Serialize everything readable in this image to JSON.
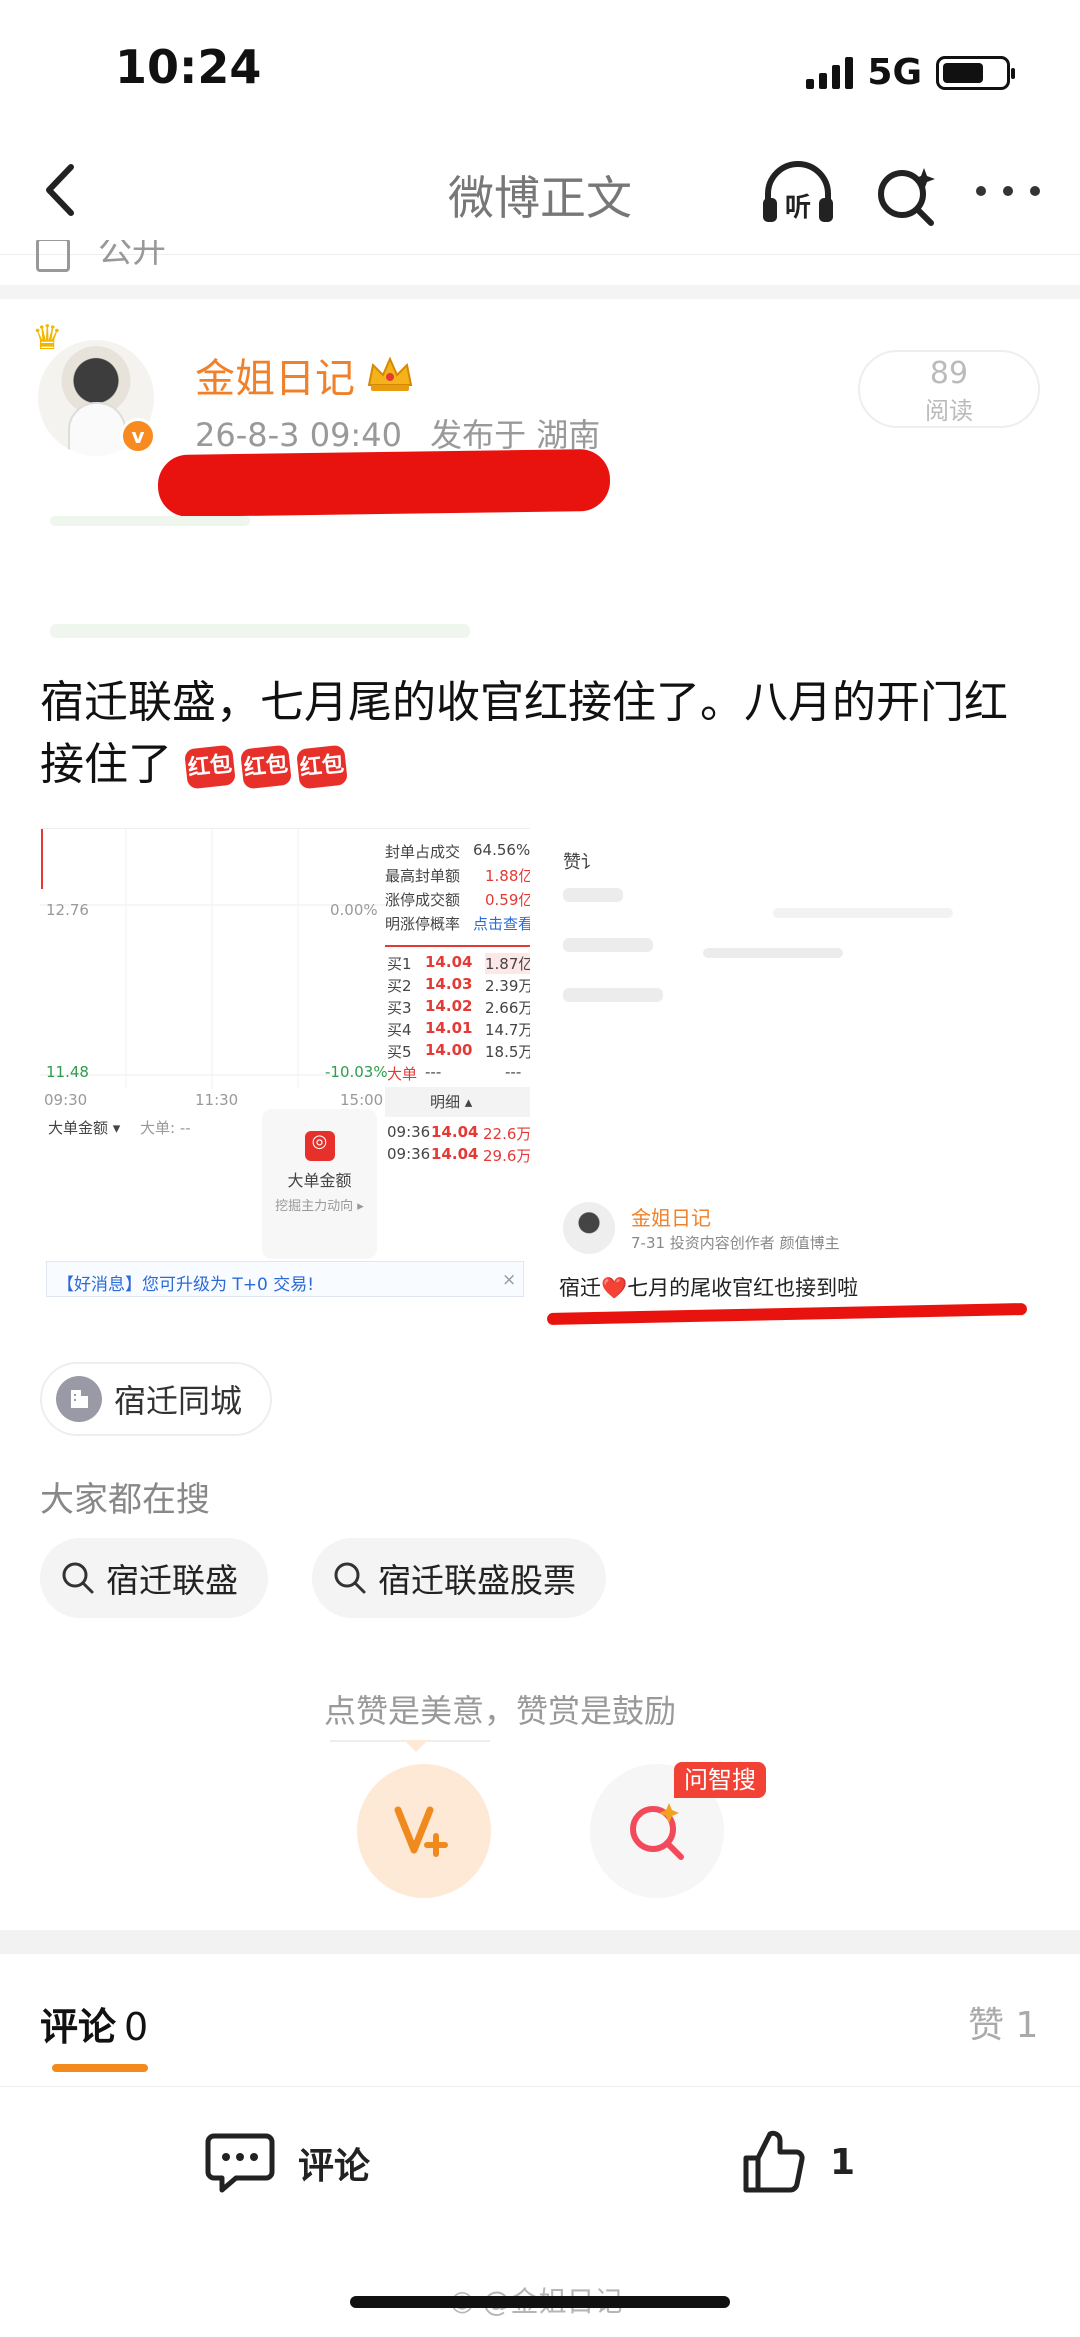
{
  "status_bar": {
    "time": "10:24",
    "network": "5G"
  },
  "nav": {
    "title": "微博正文",
    "listen_label": "听"
  },
  "cut_row": {
    "text": "公开"
  },
  "post": {
    "username": "金姐日记",
    "timestamp": "26-8-3 09:40",
    "location": "发布于 湖南",
    "read_count": "89",
    "read_label": "阅读",
    "text": "宿迁联盛，七月尾的收官红接住了。八月的开门红接住了",
    "emoji_label": "红包"
  },
  "stock_image": {
    "stats": [
      {
        "label": "封单占成交",
        "value": "64.56%"
      },
      {
        "label": "最高封单额",
        "value": "1.88亿"
      },
      {
        "label": "涨停成交额",
        "value": "0.59亿"
      },
      {
        "label": "明涨停概率",
        "value": "点击查看"
      }
    ],
    "price_top": "12.76",
    "pct_top": "0.00%",
    "price_bottom": "11.48",
    "pct_bottom": "-10.03%",
    "time_labels": [
      "09:30",
      "11:30",
      "15:00"
    ],
    "order_book": [
      {
        "label": "买1",
        "price": "14.04",
        "volume": "1.87亿"
      },
      {
        "label": "买2",
        "price": "14.03",
        "volume": "2.39万"
      },
      {
        "label": "买3",
        "price": "14.02",
        "volume": "2.66万"
      },
      {
        "label": "买4",
        "price": "14.01",
        "volume": "14.7万"
      },
      {
        "label": "买5",
        "price": "14.00",
        "volume": "18.5万"
      }
    ],
    "big_order_label": "大单",
    "big_order_value": "---",
    "detail_label": "明细 ▴",
    "trades": [
      {
        "time": "09:36",
        "price": "14.04",
        "volume": "22.6万"
      },
      {
        "time": "09:36",
        "price": "14.04",
        "volume": "29.6万"
      }
    ],
    "selector_label": "大单金额 ▾",
    "selector_value": "大单: --",
    "big_order_btn_title": "大单金额",
    "big_order_btn_sub": "挖掘主力动向 ▸",
    "notice_text": "【好消息】您可升级为 T+0 交易!",
    "notice_close": "×"
  },
  "quote_image": {
    "top_label": "赞讠",
    "name": "金姐日记",
    "meta": "7-31 投资内容创作者 颜值博主",
    "text": "宿迁❤️七月的尾收官红也接到啦"
  },
  "location_chip": "宿迁同城",
  "search_hint": "大家都在搜",
  "search_chips": [
    "宿迁联盛",
    "宿迁联盛股票"
  ],
  "appreciate": {
    "text": "点赞是美意，赞赏是鼓励",
    "ai_badge": "问智搜"
  },
  "comments_tab": {
    "label": "评论",
    "count": "0",
    "like_label": "赞",
    "like_count": "1"
  },
  "bottom_bar": {
    "comment_label": "评论",
    "like_count": "1"
  },
  "watermark": "@金姐日记",
  "colors": {
    "accent": "#f0812a",
    "redaction": "#e8130f",
    "red_text": "#e53935",
    "green_text": "#2e9d4c"
  }
}
